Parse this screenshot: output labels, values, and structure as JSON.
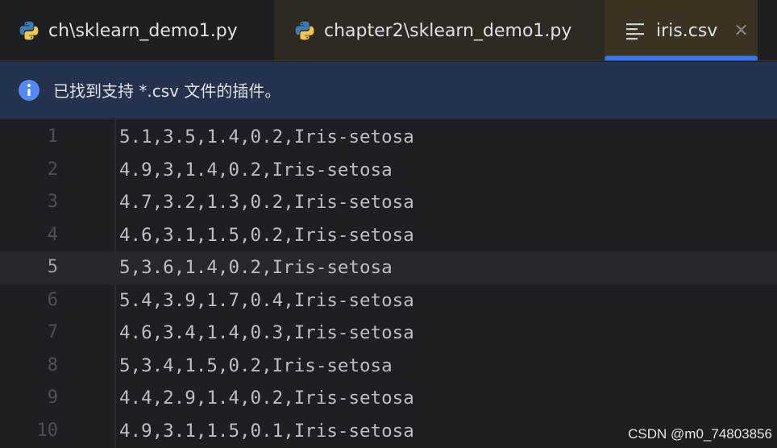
{
  "tabs": [
    {
      "label": "ch\\sklearn_demo1.py",
      "icon": "python-icon",
      "active": false
    },
    {
      "label": "chapter2\\sklearn_demo1.py",
      "icon": "python-icon",
      "active": false
    },
    {
      "label": "iris.csv",
      "icon": "text-lines-icon",
      "active": true,
      "close_glyph": "×"
    }
  ],
  "banner": {
    "icon": "info-icon",
    "message": "已找到支持 *.csv 文件的插件。"
  },
  "editor": {
    "current_line": 5,
    "lines": [
      {
        "number": "1",
        "text": "5.1,3.5,1.4,0.2,Iris-setosa"
      },
      {
        "number": "2",
        "text": "4.9,3,1.4,0.2,Iris-setosa"
      },
      {
        "number": "3",
        "text": "4.7,3.2,1.3,0.2,Iris-setosa"
      },
      {
        "number": "4",
        "text": "4.6,3.1,1.5,0.2,Iris-setosa"
      },
      {
        "number": "5",
        "text": "5,3.6,1.4,0.2,Iris-setosa"
      },
      {
        "number": "6",
        "text": "5.4,3.9,1.7,0.4,Iris-setosa"
      },
      {
        "number": "7",
        "text": "4.6,3.4,1.4,0.3,Iris-setosa"
      },
      {
        "number": "8",
        "text": "5,3.4,1.5,0.2,Iris-setosa"
      },
      {
        "number": "9",
        "text": "4.4,2.9,1.4,0.2,Iris-setosa"
      },
      {
        "number": "10",
        "text": "4.9,3.1,1.5,0.1,Iris-setosa"
      }
    ]
  },
  "watermark": "CSDN @m0_74803856",
  "colors": {
    "accent": "#3574f0",
    "banner_bg": "#25324d",
    "background": "#1e1f22"
  }
}
